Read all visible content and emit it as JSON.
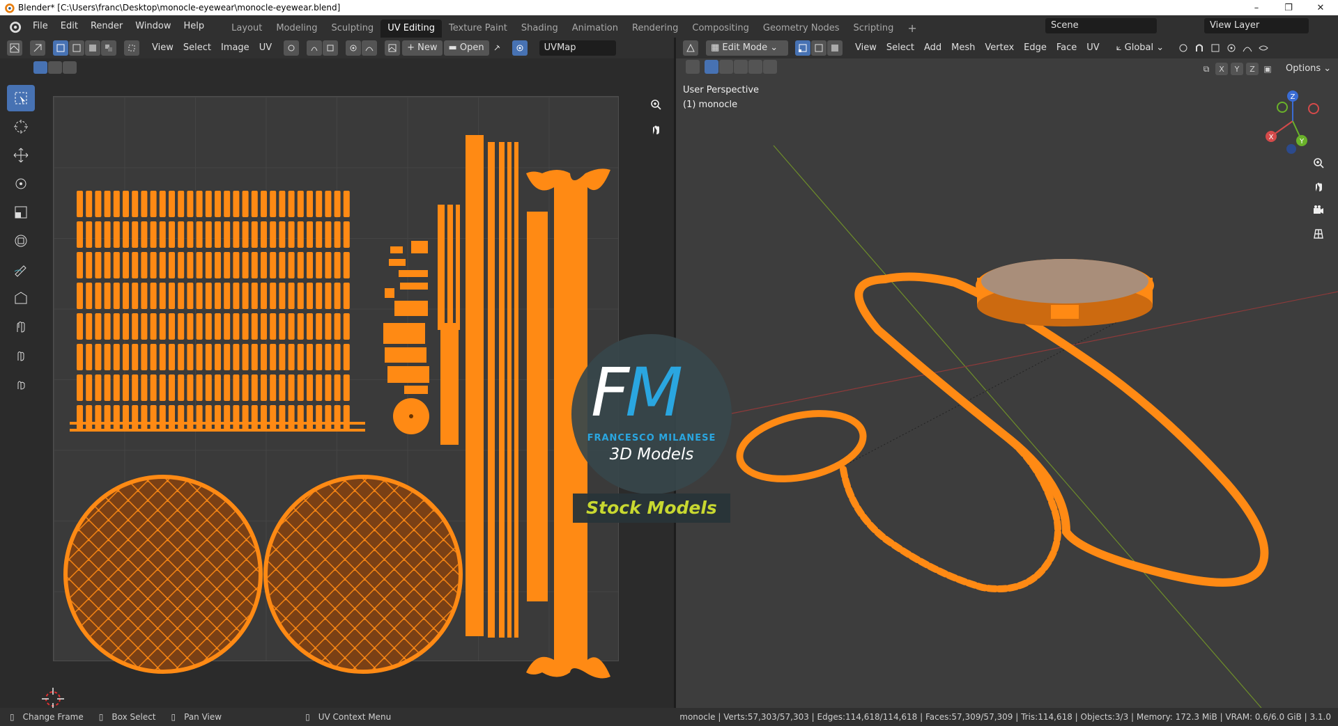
{
  "window": {
    "title": "Blender* [C:\\Users\\franc\\Desktop\\monocle-eyewear\\monocle-eyewear.blend]",
    "minimize": "–",
    "maximize": "❐",
    "close": "✕"
  },
  "menu": [
    "File",
    "Edit",
    "Render",
    "Window",
    "Help"
  ],
  "workspaces": [
    {
      "label": "Layout",
      "active": false
    },
    {
      "label": "Modeling",
      "active": false
    },
    {
      "label": "Sculpting",
      "active": false
    },
    {
      "label": "UV Editing",
      "active": true
    },
    {
      "label": "Texture Paint",
      "active": false
    },
    {
      "label": "Shading",
      "active": false
    },
    {
      "label": "Animation",
      "active": false
    },
    {
      "label": "Rendering",
      "active": false
    },
    {
      "label": "Compositing",
      "active": false
    },
    {
      "label": "Geometry Nodes",
      "active": false
    },
    {
      "label": "Scripting",
      "active": false
    }
  ],
  "add_workspace": "+",
  "scene": {
    "label": "Scene",
    "view_layer": "View Layer"
  },
  "uv_editor": {
    "menus": [
      "View",
      "Select",
      "Image",
      "UV"
    ],
    "new_label": "New",
    "open_label": "Open",
    "uvmap": "UVMap"
  },
  "viewport": {
    "mode": "Edit Mode",
    "menus": [
      "View",
      "Select",
      "Add",
      "Mesh",
      "Vertex",
      "Edge",
      "Face",
      "UV"
    ],
    "transform_orientation": "Global",
    "axes": [
      "X",
      "Y",
      "Z"
    ],
    "options": "Options",
    "perspective": "User Perspective",
    "object": "(1) monocle",
    "gizmo": {
      "x": "X",
      "y": "Y",
      "z": "Z"
    }
  },
  "watermark": {
    "letters_f": "F",
    "letters_m": "M",
    "author": "FRANCESCO MILANESE",
    "subtitle": "3D Models",
    "banner": "Stock Models"
  },
  "statusbar": {
    "items": [
      "Change Frame",
      "Box Select",
      "Pan View",
      "UV Context Menu"
    ],
    "stats": "monocle | Verts:57,303/57,303 | Edges:114,618/114,618 | Faces:57,309/57,309 | Tris:114,618 | Objects:3/3 | Memory: 172.3 MiB | VRAM: 0.6/6.0 GiB | 3.1.0"
  },
  "colors": {
    "accent": "#4772b3",
    "selection": "#ff8a14",
    "header": "#303030",
    "background": "#2b2b2b"
  }
}
